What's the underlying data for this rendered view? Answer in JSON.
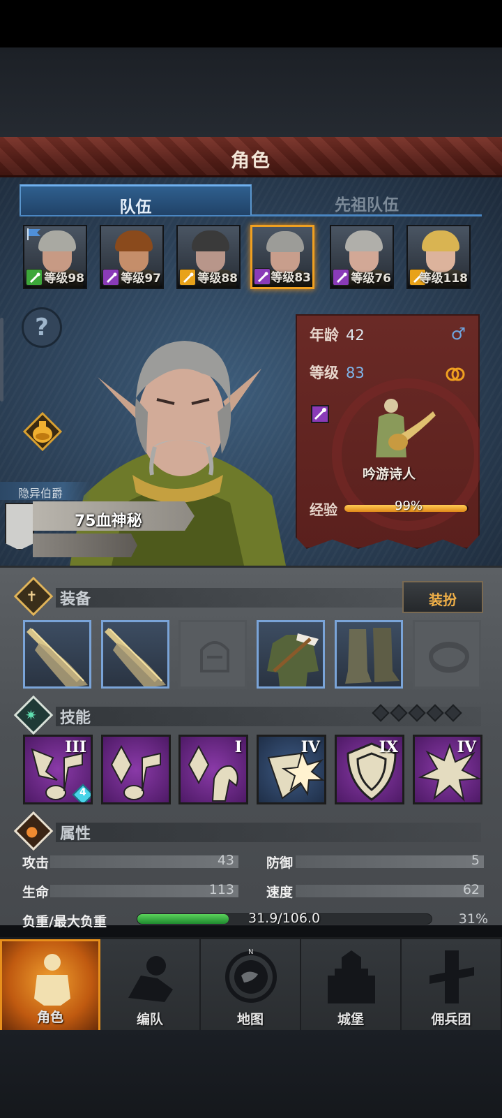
{
  "title": "角色",
  "tabs": [
    {
      "label": "队伍",
      "active": true
    },
    {
      "label": "先祖队伍",
      "active": false
    }
  ],
  "party": [
    {
      "level": "等级98",
      "class_icon": "bow-icon",
      "class_color": "#3da73a",
      "hair": "#a9a9a2",
      "skin": "#c79a84",
      "flag": true
    },
    {
      "level": "等级97",
      "class_icon": "staff-icon",
      "class_color": "#8a3bb8",
      "hair": "#8a4a1c",
      "skin": "#c58e6a"
    },
    {
      "level": "等级88",
      "class_icon": "shield-icon",
      "class_color": "#e8a21a",
      "hair": "#3a3a3a",
      "skin": "#b8968a"
    },
    {
      "level": "等级83",
      "class_icon": "staff-icon",
      "class_color": "#8a3bb8",
      "hair": "#9c9c98",
      "skin": "#c89e8c",
      "selected": true
    },
    {
      "level": "等级76",
      "class_icon": "staff-icon",
      "class_color": "#8a3bb8",
      "hair": "#b0afaa",
      "skin": "#d2a896"
    },
    {
      "level": "等级118",
      "class_icon": "shield-icon",
      "class_color": "#e8a21a",
      "hair": "#d9b452",
      "skin": "#dcb39c"
    }
  ],
  "character": {
    "trait": "隐异伯爵",
    "bloodline": "75血神秘",
    "age_label": "年龄",
    "age": "42",
    "level_label": "等级",
    "level": "83",
    "gender_symbol": "♂",
    "class_name": "吟游诗人",
    "exp_label": "经验",
    "exp_text": "99%",
    "exp_fraction": 0.99
  },
  "equipment": {
    "title": "装备",
    "dress_button": "装扮",
    "slots": [
      {
        "name": "weapon-slot-1",
        "item": "sword",
        "empty": false
      },
      {
        "name": "weapon-slot-2",
        "item": "sword",
        "empty": false
      },
      {
        "name": "helmet-slot",
        "item": "helmet",
        "empty": true
      },
      {
        "name": "armor-slot",
        "item": "tunic",
        "empty": false
      },
      {
        "name": "boots-slot",
        "item": "boots",
        "empty": false
      },
      {
        "name": "ring-slot",
        "item": "ring",
        "empty": true
      }
    ]
  },
  "skills": {
    "title": "技能",
    "gem_count": 5,
    "list": [
      {
        "rank": "III",
        "style": "purple",
        "icon": "music-note-icon",
        "badge": "4"
      },
      {
        "rank": "",
        "style": "purple",
        "icon": "crystal-note-icon"
      },
      {
        "rank": "I",
        "style": "purple",
        "icon": "crystal-hand-icon"
      },
      {
        "rank": "IV",
        "style": "blue",
        "icon": "shield-burst-icon"
      },
      {
        "rank": "IX",
        "style": "purple",
        "icon": "shield-icon"
      },
      {
        "rank": "IV",
        "style": "purple",
        "icon": "burst-icon"
      }
    ]
  },
  "attributes": {
    "title": "属性",
    "attack_label": "攻击",
    "attack": "43",
    "defense_label": "防御",
    "defense": "5",
    "hp_label": "生命",
    "hp": "113",
    "speed_label": "速度",
    "speed": "62",
    "load_label": "负重/最大负重",
    "load": "31.9/106.0",
    "load_pct": "31%",
    "load_fraction": 0.31
  },
  "nav": [
    {
      "label": "角色",
      "icon": "knight-icon",
      "active": true
    },
    {
      "label": "编队",
      "icon": "formation-icon"
    },
    {
      "label": "地图",
      "icon": "compass-map-icon",
      "compass": "N"
    },
    {
      "label": "城堡",
      "icon": "castle-icon"
    },
    {
      "label": "佣兵团",
      "icon": "mercenary-icon"
    }
  ]
}
